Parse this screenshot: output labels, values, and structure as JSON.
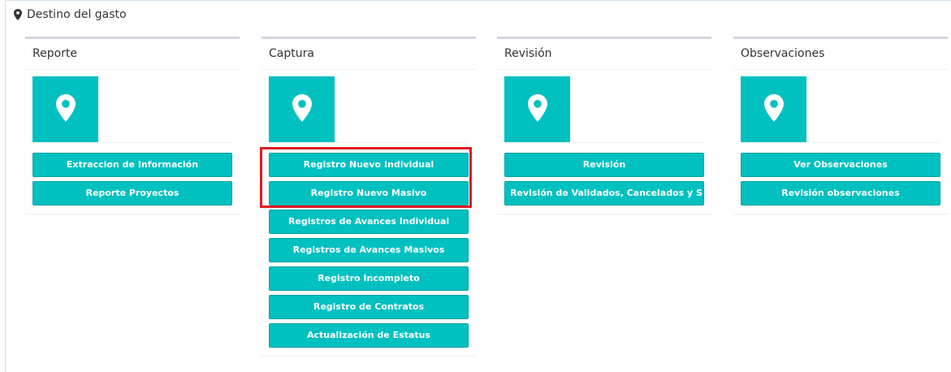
{
  "panel": {
    "title": "Destino del gasto",
    "icon": "map-marker-icon"
  },
  "colors": {
    "accent": "#00c0c0",
    "accent_border": "#00a3a3",
    "highlight": "#e01b24",
    "card_top": "#d2d6de"
  },
  "cards": [
    {
      "title": "Reporte",
      "icon": "map-marker-icon",
      "buttons": [
        "Extraccion de Información",
        "Reporte Proyectos"
      ]
    },
    {
      "title": "Captura",
      "icon": "map-marker-icon",
      "buttons": [
        "Registro Nuevo Individual",
        "Registro Nuevo Masivo",
        "Registros de Avances Individual",
        "Registros de Avances Masivos",
        "Registro Incompleto",
        "Registro de Contratos",
        "Actualización de Estatus"
      ]
    },
    {
      "title": "Revisión",
      "icon": "map-marker-icon",
      "buttons": [
        "Revisión",
        "Revisión de Validados, Cancelados y Suspendidos"
      ]
    },
    {
      "title": "Observaciones",
      "icon": "map-marker-icon",
      "buttons": [
        "Ver Observaciones",
        "Revisión observaciones"
      ]
    }
  ]
}
